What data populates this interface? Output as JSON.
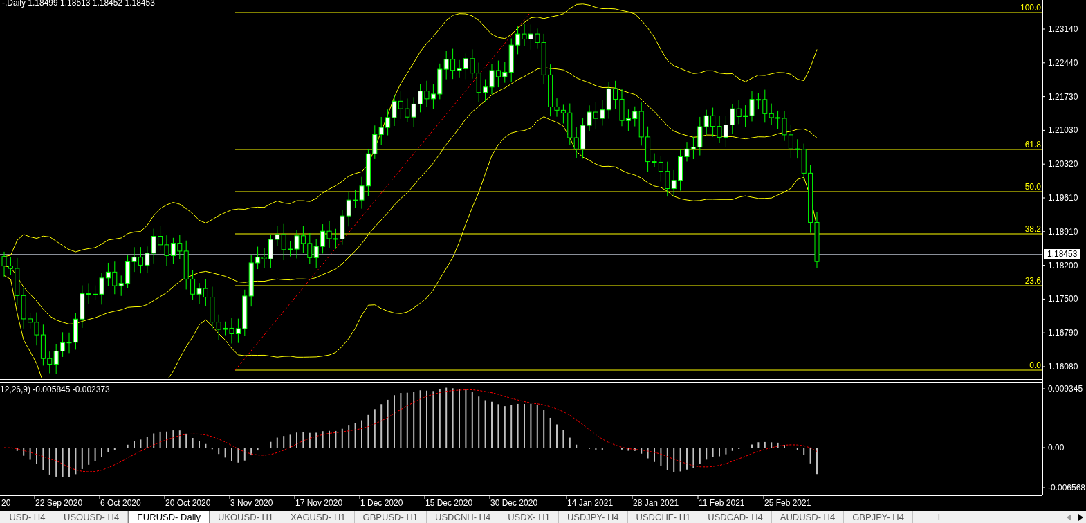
{
  "chart": {
    "header": "-,Daily  1.18499 1.18513 1.18452 1.18453",
    "price_axis": [
      "1.23140",
      "1.22440",
      "1.21730",
      "1.21030",
      "1.20320",
      "1.19610",
      "1.18910",
      "1.18200",
      "1.17500",
      "1.16790",
      "1.16080"
    ],
    "fib_levels": [
      {
        "label": "100.0"
      },
      {
        "label": "61.8"
      },
      {
        "label": "50.0"
      },
      {
        "label": "38.2"
      },
      {
        "label": "23.6"
      },
      {
        "label": "0.0"
      }
    ],
    "current_price": "1.18453",
    "macd": {
      "header": "12,26,9) -0.005845 -0.002373",
      "axis": [
        "0.009345",
        "0.00",
        "-0.006568"
      ]
    },
    "dates": [
      "20",
      "22 Sep 2020",
      "6 Oct 2020",
      "20 Oct 2020",
      "3 Nov 2020",
      "17 Nov 2020",
      "1 Dec 2020",
      "15 Dec 2020",
      "30 Dec 2020",
      "14 Jan 2021",
      "28 Jan 2021",
      "11 Feb 2021",
      "25 Feb 2021"
    ]
  },
  "tabs": [
    {
      "label": "USD- H4",
      "selected": false
    },
    {
      "label": "USOUSD- H4",
      "selected": false
    },
    {
      "label": "EURUSD- Daily",
      "selected": true
    },
    {
      "label": "UKOUSD- H1",
      "selected": false
    },
    {
      "label": "XAGUSD- H1",
      "selected": false
    },
    {
      "label": "GBPUSD- H1",
      "selected": false
    },
    {
      "label": "USDCNH- H4",
      "selected": false
    },
    {
      "label": "USDX- H1",
      "selected": false
    },
    {
      "label": "USDJPY- H4",
      "selected": false
    },
    {
      "label": "USDCHF- H1",
      "selected": false
    },
    {
      "label": "USDCAD- H4",
      "selected": false
    },
    {
      "label": "AUDUSD- H4",
      "selected": false
    },
    {
      "label": "GBPJPY- H4",
      "selected": false
    },
    {
      "label": "L",
      "selected": false
    }
  ]
}
